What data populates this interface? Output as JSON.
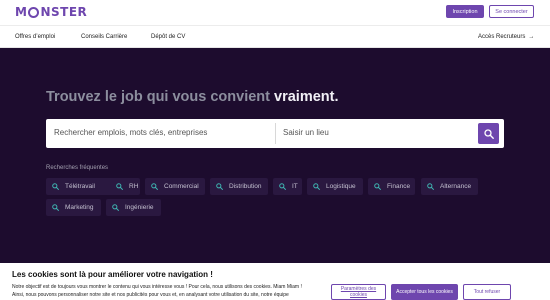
{
  "header": {
    "logo_text_left": "M",
    "logo_text_right": "NSTER",
    "signup_label": "Inscription",
    "login_label": "Se connecter"
  },
  "nav": {
    "items": [
      "Offres d’emploi",
      "Conseils Carrière",
      "Dépôt de CV"
    ],
    "recruiters_label": "Accès Recruteurs",
    "recruiters_icon": "arrow-right-icon"
  },
  "hero": {
    "headline_main": "Trouvez le job qui vous convient ",
    "headline_accent": "vraiment."
  },
  "search": {
    "what_placeholder": "Rechercher emplois, mots clés, entreprises",
    "where_placeholder": "Saisir un lieu",
    "button_icon": "search-icon"
  },
  "frequent": {
    "label": "Recherches fréquentes",
    "chips": [
      "Télétravail",
      "RH",
      "Commercial",
      "Distribution",
      "IT",
      "Logistique",
      "Finance",
      "Alternance",
      "Marketing",
      "Ingénierie"
    ]
  },
  "cookies": {
    "title": "Les cookies sont là pour améliorer votre navigation !",
    "line1": "Notre objectif est de toujours vous montrer le contenu qui vous intéresse vous ! Pour cela, nous utilisons des cookies. Miam Miam !",
    "line2": "Ainsi, nous pouvons personnaliser notre site et nos publicités pour vous et, en analysant votre utilisation du site, notre équipe",
    "settings_label": "Paramètres des cookies",
    "accept_label": "Accepter tous les cookies",
    "refuse_label": "Tout refuser"
  },
  "colors": {
    "brand_purple": "#6e46ae",
    "hero_bg": "#1d0c2e",
    "chip_bg": "#2a1840",
    "search_icon_teal": "#3fb6b2"
  }
}
